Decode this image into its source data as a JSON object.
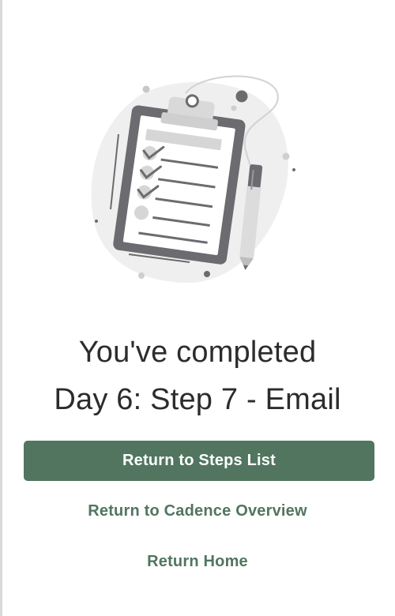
{
  "completion": {
    "line1": "You've completed",
    "line2": "Day 6: Step 7 - Email"
  },
  "actions": {
    "primary_label": "Return to Steps List",
    "cadence_link_label": "Return to Cadence Overview",
    "home_link_label": "Return Home"
  },
  "illustration": {
    "icon": "clipboard-checklist-illustration",
    "checked_items": 3,
    "total_items": 5
  },
  "colors": {
    "accent": "#527560",
    "text": "#2c2c2c",
    "background": "#ffffff",
    "illustration_dark": "#6b6b70",
    "illustration_light": "#ededed"
  }
}
